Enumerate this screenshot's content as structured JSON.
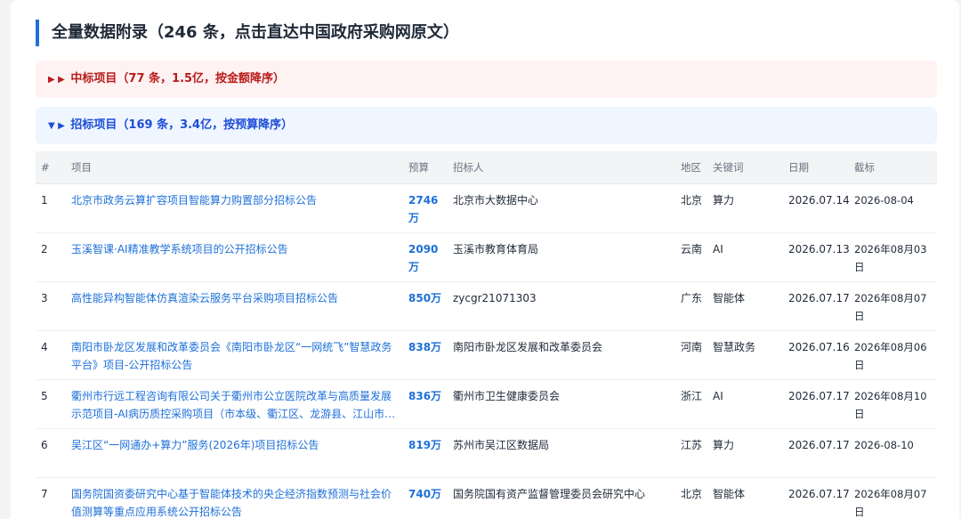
{
  "section_title": "全量数据附录（246 条，点击直达中国政府采购网原文）",
  "groups": {
    "won": {
      "arrow": "▶ ▶",
      "label": "中标项目（77 条，1.5亿，按金额降序）"
    },
    "bid": {
      "arrow": "▼ ▶",
      "label": "招标项目（169 条，3.4亿，按预算降序）"
    }
  },
  "table": {
    "headers": {
      "num": "#",
      "project": "项目",
      "budget": "预算",
      "bidder": "招标人",
      "region": "地区",
      "keyword": "关键词",
      "date": "日期",
      "deadline": "截标"
    },
    "rows": [
      {
        "num": "1",
        "project": "北京市政务云算扩容项目智能算力购置部分招标公告",
        "budget": "2746万",
        "bidder": "北京市大数据中心",
        "region": "北京",
        "keyword": "算力",
        "date": "2026.07.14",
        "deadline": "2026-08-04"
      },
      {
        "num": "2",
        "project": "玉溪智课·AI精准教学系统项目的公开招标公告",
        "budget": "2090万",
        "bidder": "玉溪市教育体育局",
        "region": "云南",
        "keyword": "AI",
        "date": "2026.07.13",
        "deadline": "2026年08月03日"
      },
      {
        "num": "3",
        "project": "高性能异构智能体仿真渲染云服务平台采购项目招标公告",
        "budget": "850万",
        "bidder": "zycgr21071303",
        "region": "广东",
        "keyword": "智能体",
        "date": "2026.07.17",
        "deadline": "2026年08月07日"
      },
      {
        "num": "4",
        "project": "南阳市卧龙区发展和改革委员会《南阳市卧龙区“一网统飞”智慧政务平台》项目-公开招标公告",
        "budget": "838万",
        "bidder": "南阳市卧龙区发展和改革委员会",
        "region": "河南",
        "keyword": "智慧政务",
        "date": "2026.07.16",
        "deadline": "2026年08月06日"
      },
      {
        "num": "5",
        "project": "衢州市行远工程咨询有限公司关于衢州市公立医院改革与高质量发展示范项目-AI病历质控采购项目（市本级、衢江区、龙游县、江山市、常山县、开化县）的公开招标公告",
        "budget": "836万",
        "bidder": "衢州市卫生健康委员会",
        "region": "浙江",
        "keyword": "AI",
        "date": "2026.07.17",
        "deadline": "2026年08月10日"
      },
      {
        "num": "6",
        "project": "吴江区“一网通办+算力”服务(2026年)项目招标公告",
        "budget": "819万",
        "bidder": "苏州市吴江区数据局",
        "region": "江苏",
        "keyword": "算力",
        "date": "2026.07.17",
        "deadline": "2026-08-10"
      },
      {
        "num": "7",
        "project": "国务院国资委研究中心基于智能体技术的央企经济指数预测与社会价值测算等重点应用系统公开招标公告",
        "budget": "740万",
        "bidder": "国务院国有资产监督管理委员会研究中心",
        "region": "北京",
        "keyword": "智能体",
        "date": "2026.07.17",
        "deadline": "2026年08月07日"
      }
    ]
  },
  "colors": {
    "accent": "#1d6fd9",
    "won_text": "#b91c1c",
    "won_bg": "#fef2f2",
    "bid_text": "#1d4ed8",
    "bid_bg": "#eff6ff"
  }
}
